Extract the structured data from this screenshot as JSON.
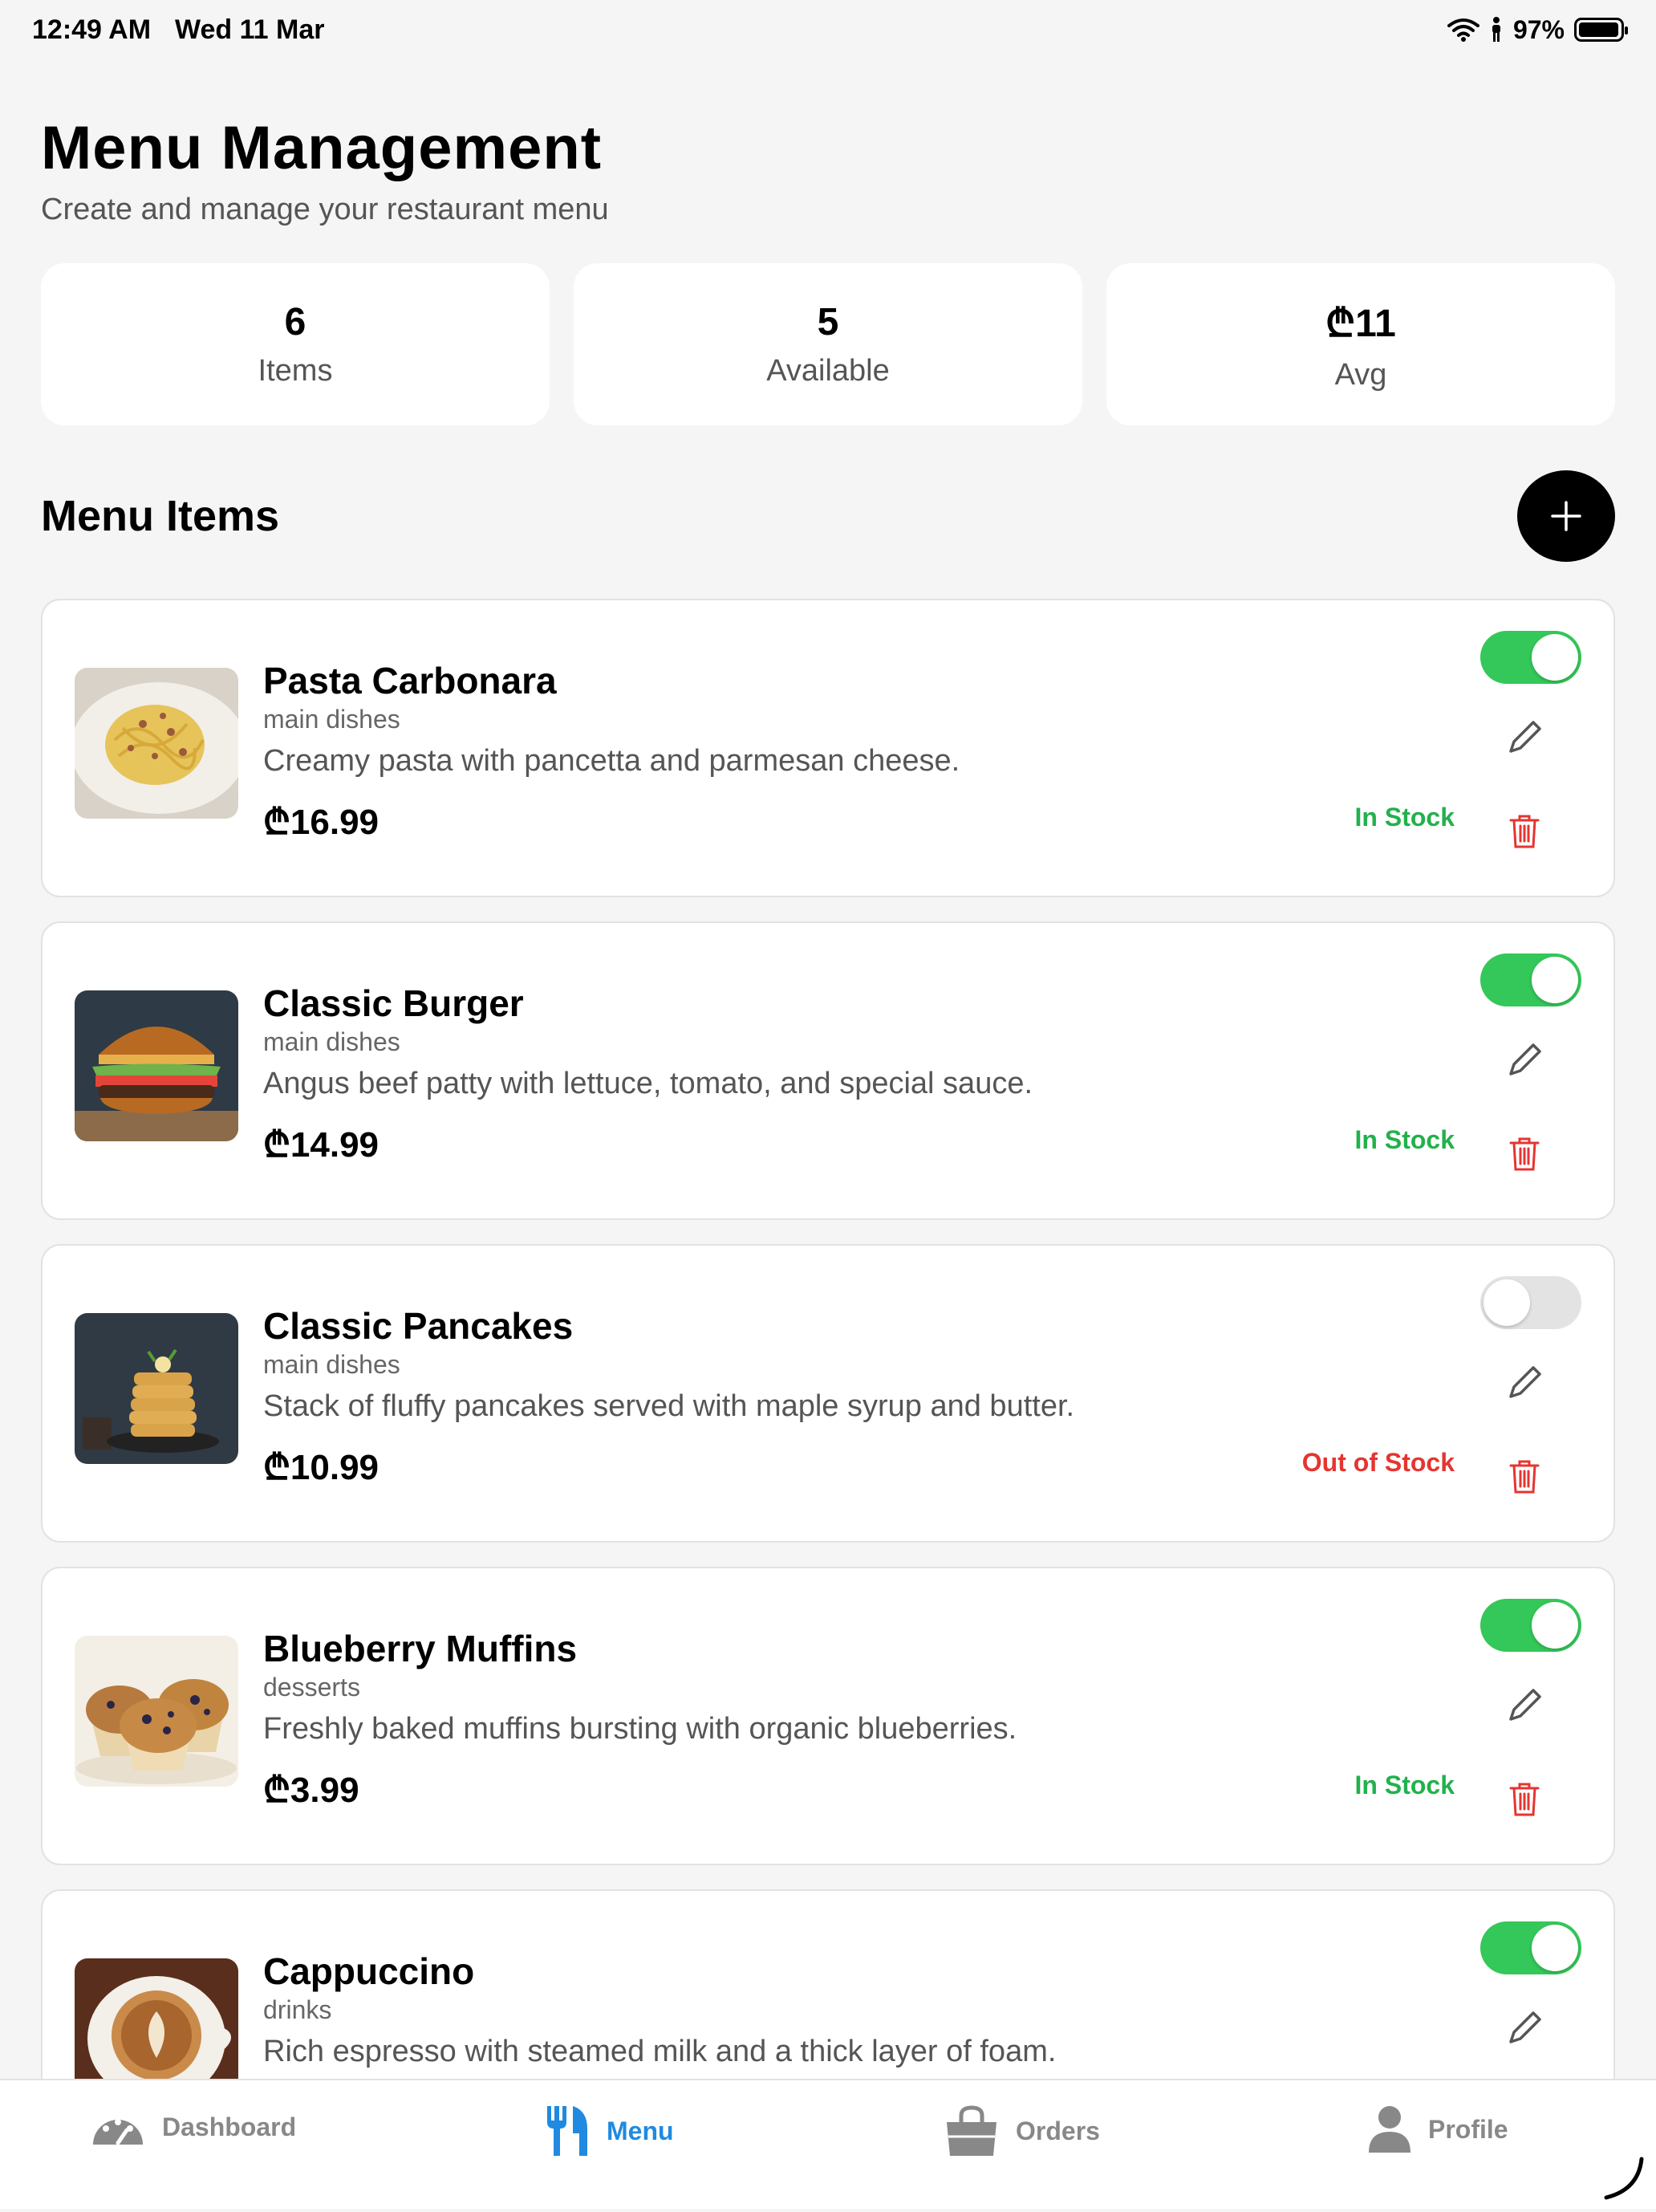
{
  "status_bar": {
    "time": "12:49 AM",
    "date": "Wed 11 Mar",
    "battery": "97%",
    "battery_level": 0.97,
    "icons": [
      "wifi-icon",
      "accessibility-icon",
      "battery-icon"
    ]
  },
  "header": {
    "title": "Menu Management",
    "subtitle": "Create and manage your restaurant menu"
  },
  "stats": [
    {
      "value": "6",
      "label": "Items"
    },
    {
      "value": "5",
      "label": "Available"
    },
    {
      "value": "₾11",
      "label": "Avg"
    }
  ],
  "section": {
    "title": "Menu Items",
    "add_icon": "plus-icon"
  },
  "items": [
    {
      "name": "Pasta Carbonara",
      "category": "main dishes",
      "description": "Creamy pasta with pancetta and parmesan cheese.",
      "price": "₾16.99",
      "stock": "In Stock",
      "available": true,
      "image": "pasta-photo"
    },
    {
      "name": "Classic Burger",
      "category": "main dishes",
      "description": "Angus beef patty with lettuce, tomato, and special sauce.",
      "price": "₾14.99",
      "stock": "In Stock",
      "available": true,
      "image": "burger-photo"
    },
    {
      "name": "Classic Pancakes",
      "category": "main dishes",
      "description": "Stack of fluffy pancakes served with maple syrup and butter.",
      "price": "₾10.99",
      "stock": "Out of Stock",
      "available": false,
      "image": "pancakes-photo"
    },
    {
      "name": "Blueberry Muffins",
      "category": "desserts",
      "description": "Freshly baked muffins bursting with organic blueberries.",
      "price": "₾3.99",
      "stock": "In Stock",
      "available": true,
      "image": "muffins-photo"
    },
    {
      "name": "Cappuccino",
      "category": "drinks",
      "description": "Rich espresso with steamed milk and a thick layer of foam.",
      "available": true,
      "image": "cappuccino-photo"
    }
  ],
  "colors": {
    "toggle_on": "#34c759",
    "toggle_off": "#e3e3e3",
    "in_stock": "#22b14c",
    "out_of_stock": "#e53530",
    "active_tab": "#1f8ae0",
    "delete": "#e53530"
  },
  "tabbar": [
    {
      "label": "Dashboard",
      "icon": "dashboard-icon",
      "active": false
    },
    {
      "label": "Menu",
      "icon": "fork-knife-icon",
      "active": true
    },
    {
      "label": "Orders",
      "icon": "shopping-bag-icon",
      "active": false
    },
    {
      "label": "Profile",
      "icon": "person-icon",
      "active": false
    }
  ]
}
